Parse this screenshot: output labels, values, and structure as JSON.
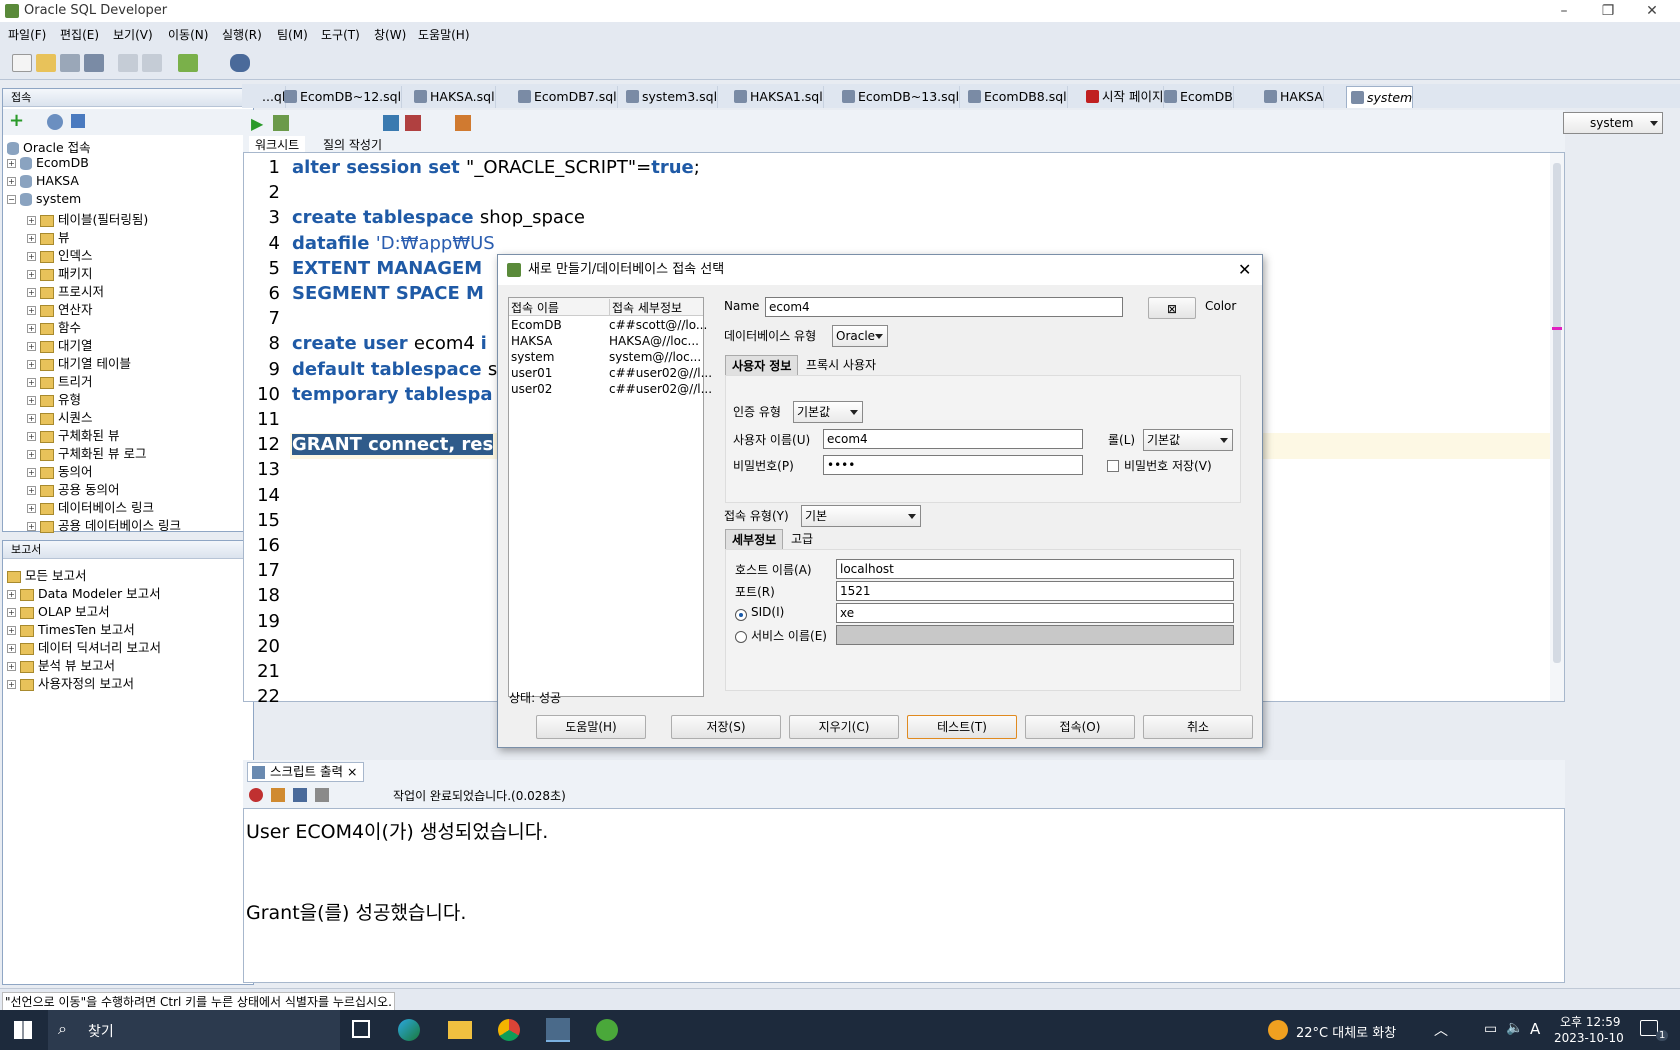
{
  "app": {
    "title": "Oracle SQL Developer"
  },
  "menu": [
    "파일(F)",
    "편집(E)",
    "보기(V)",
    "이동(N)",
    "실행(R)",
    "팀(M)",
    "도구(T)",
    "창(W)",
    "도움말(H)"
  ],
  "connections_panel": {
    "title": "접속",
    "root": "Oracle 접속",
    "items": [
      "EcomDB",
      "HAKSA",
      "system"
    ],
    "system_children": [
      "테이블(필터링됨)",
      "뷰",
      "인덱스",
      "패키지",
      "프로시저",
      "연산자",
      "함수",
      "대기열",
      "대기열 테이블",
      "트리거",
      "유형",
      "시퀀스",
      "구체화된 뷰",
      "구체화된 뷰 로그",
      "동의어",
      "공용 동의어",
      "데이터베이스 링크",
      "공용 데이터베이스 링크"
    ]
  },
  "reports_panel": {
    "title": "보고서",
    "root": "모든 보고서",
    "items": [
      "Data Modeler 보고서",
      "OLAP 보고서",
      "TimesTen 보고서",
      "데이터 딕셔너리 보고서",
      "분석 뷰 보고서",
      "사용자정의 보고서"
    ]
  },
  "editor_tabs": [
    "...ql",
    "EcomDB~12.sql",
    "HAKSA.sql",
    "EcomDB7.sql",
    "system3.sql",
    "HAKSA1.sql",
    "EcomDB~13.sql",
    "EcomDB8.sql",
    "시작 페이지",
    "EcomDB",
    "HAKSA",
    "system"
  ],
  "connection_selector": "system",
  "subtabs": [
    "워크시트",
    "질의 작성기"
  ],
  "code_lines": [
    [
      {
        "t": "alter session set ",
        "k": true
      },
      {
        "t": "\"_ORACLE_SCRIPT\"=",
        "k": false
      },
      {
        "t": "true",
        "k": true
      },
      {
        "t": ";",
        "k": false
      }
    ],
    [],
    [
      {
        "t": "create tablespace ",
        "k": true
      },
      {
        "t": "shop_space",
        "k": false
      }
    ],
    [
      {
        "t": "datafile ",
        "k": true
      },
      {
        "t": "'D:₩app₩US",
        "s": true
      }
    ],
    [
      {
        "t": "EXTENT MANAGEM",
        "k": true
      }
    ],
    [
      {
        "t": "SEGMENT SPACE M",
        "k": true
      }
    ],
    [],
    [
      {
        "t": "create user ",
        "k": true
      },
      {
        "t": "ecom4 ",
        "k": false
      },
      {
        "t": "i",
        "k": true
      }
    ],
    [
      {
        "t": "default tablespace ",
        "k": true
      },
      {
        "t": "s",
        "k": false
      }
    ],
    [
      {
        "t": "temporary tablespa",
        "k": true
      }
    ],
    [],
    [
      {
        "t": "GRANT connect, res",
        "k": true,
        "sel": true
      }
    ]
  ],
  "line_numbers": [
    "1",
    "2",
    "3",
    "4",
    "5",
    "6",
    "7",
    "8",
    "9",
    "10",
    "11",
    "12",
    "13",
    "14",
    "15",
    "16",
    "17",
    "18",
    "19",
    "20",
    "21",
    "22"
  ],
  "dialog": {
    "title": "새로 만들기/데이터베이스 접속 선택",
    "list_headers": [
      "접속 이름",
      "접속 세부정보"
    ],
    "list_rows": [
      [
        "EcomDB",
        "c##scott@//lo..."
      ],
      [
        "HAKSA",
        "HAKSA@//loc..."
      ],
      [
        "system",
        "system@//loc..."
      ],
      [
        "user01",
        "c##user02@//l..."
      ],
      [
        "user02",
        "c##user02@//l..."
      ]
    ],
    "status": "상태: 성공",
    "name_label": "Name",
    "name_value": "ecom4",
    "color_label": "Color",
    "db_type_label": "데이터베이스 유형",
    "db_type_value": "Oracle",
    "tabs": [
      "사용자 정보",
      "프록시 사용자"
    ],
    "auth_label": "인증 유형",
    "auth_value": "기본값",
    "user_label": "사용자 이름(U)",
    "user_value": "ecom4",
    "role_label": "롤(L)",
    "role_value": "기본값",
    "password_label": "비밀번호(P)",
    "password_value": "••••",
    "save_pw_label": "비밀번호 저장(V)",
    "conn_type_label": "접속 유형(Y)",
    "conn_type_value": "기본",
    "detail_tabs": [
      "세부정보",
      "고급"
    ],
    "host_label": "호스트 이름(A)",
    "host_value": "localhost",
    "port_label": "포트(R)",
    "port_value": "1521",
    "sid_label": "SID(I)",
    "sid_value": "xe",
    "service_label": "서비스 이름(E)",
    "buttons": [
      "도움말(H)",
      "저장(S)",
      "지우기(C)",
      "테스트(T)",
      "접속(O)",
      "취소"
    ]
  },
  "output": {
    "tab": "스크립트 출력",
    "status": "작업이 완료되었습니다.(0.028초)",
    "lines": [
      "User ECOM4이(가) 생성되었습니다.",
      "",
      "",
      "Grant을(를) 성공했습니다."
    ]
  },
  "statusbar": "\"선언으로 이동\"을 수행하려면 Ctrl 키를 누른 상태에서 식별자를 누르십시오.",
  "taskbar": {
    "search": "찾기",
    "weather": "22°C 대체로 화창",
    "time": "오후 12:59",
    "date": "2023-10-10",
    "ime": "A",
    "notif": "1"
  }
}
